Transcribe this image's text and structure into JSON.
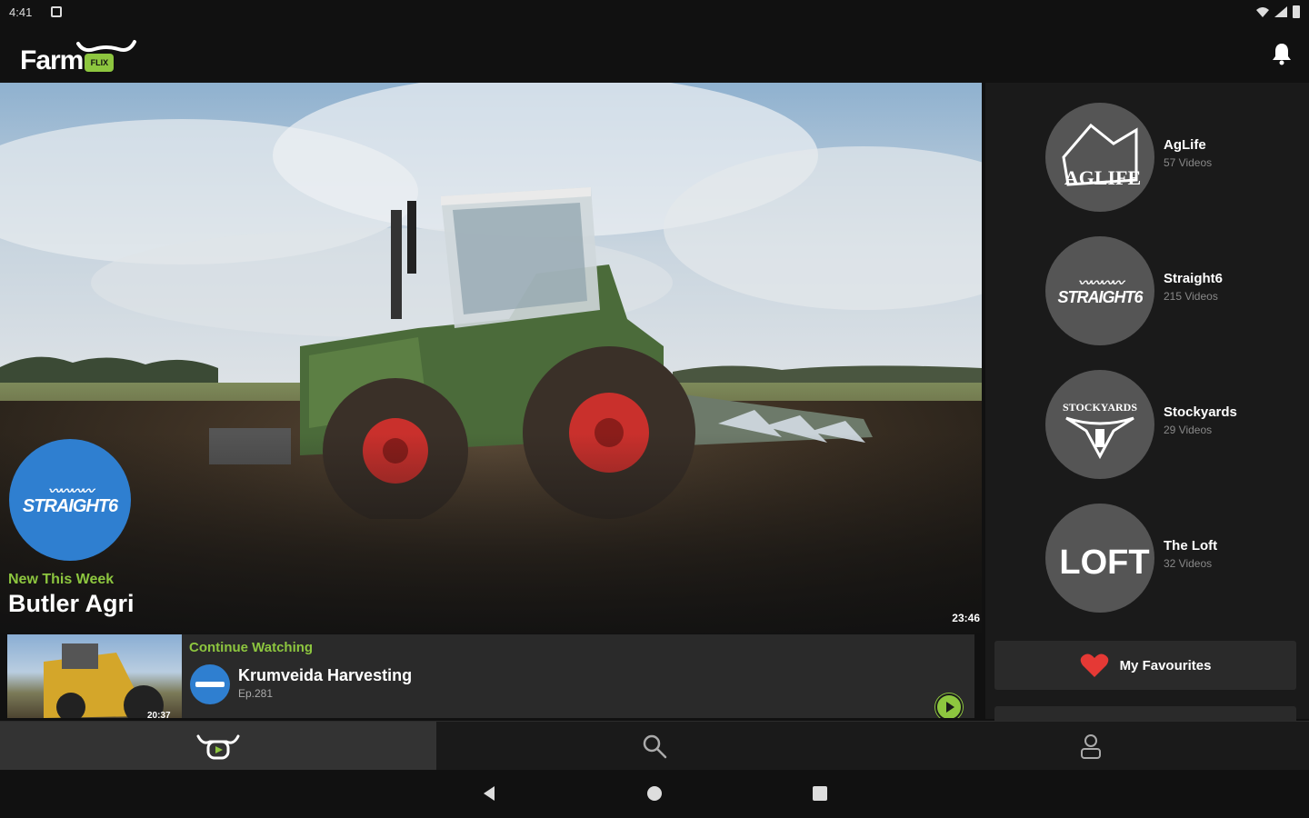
{
  "status_bar": {
    "time": "4:41"
  },
  "app_bar": {
    "logo_text": "Farm",
    "logo_badge": "FLIX"
  },
  "hero": {
    "tag": "New This Week",
    "title": "Butler Agri",
    "duration": "23:46",
    "channel_logo_text": "STRAIGHT6"
  },
  "continue_watching": {
    "label": "Continue Watching",
    "title": "Krumveida Harvesting",
    "episode": "Ep.281",
    "thumb_time": "20:37"
  },
  "channels": [
    {
      "name": "AgLife",
      "count": "57 Videos",
      "logo_text": "AGLIFE"
    },
    {
      "name": "Straight6",
      "count": "215 Videos",
      "logo_text": "STRAIGHT6"
    },
    {
      "name": "Stockyards",
      "count": "29 Videos",
      "logo_text": "STOCKYARDS"
    },
    {
      "name": "The Loft",
      "count": "32 Videos",
      "logo_text": "LOFT"
    }
  ],
  "favourites_label": "My Favourites",
  "bottom_nav": [
    {
      "icon": "farmflix-icon",
      "active": true
    },
    {
      "icon": "search-icon",
      "active": false
    },
    {
      "icon": "profile-icon",
      "active": false
    }
  ],
  "colors": {
    "accent": "#8dc63f",
    "straight6_blue": "#2f7fd0",
    "favourite_red": "#e53935"
  }
}
